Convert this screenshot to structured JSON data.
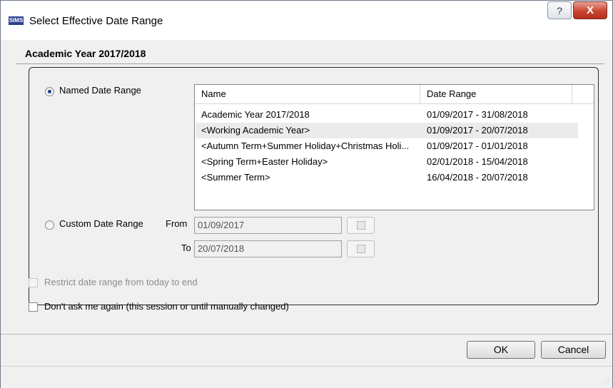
{
  "window": {
    "title": "Select Effective Date Range",
    "app_icon_text": "SIMS",
    "help_label": "?",
    "close_label": "X"
  },
  "group": {
    "title": "Academic Year 2017/2018"
  },
  "named_range": {
    "label": "Named Date Range",
    "checked": true
  },
  "list": {
    "columns": [
      "Name",
      "Date Range"
    ],
    "rows": [
      {
        "name": "Academic Year 2017/2018",
        "range": "01/09/2017 - 31/08/2018"
      },
      {
        "name": "<Working Academic Year>",
        "range": "01/09/2017 - 20/07/2018"
      },
      {
        "name": "<Autumn Term+Summer Holiday+Christmas Holi...",
        "range": "01/09/2017 - 01/01/2018"
      },
      {
        "name": "<Spring Term+Easter Holiday>",
        "range": "02/01/2018 - 15/04/2018"
      },
      {
        "name": "<Summer Term>",
        "range": "16/04/2018 - 20/07/2018"
      }
    ],
    "selected_index": 1
  },
  "custom_range": {
    "label": "Custom Date Range",
    "from_label": "From",
    "from_value": "01/09/2017",
    "to_label": "To",
    "to_value": "20/07/2018"
  },
  "options": {
    "restrict_label": "Restrict date range from today to end",
    "dont_ask_label": "Don't ask me again (this session or until manually changed)"
  },
  "buttons": {
    "ok": "OK",
    "cancel": "Cancel"
  },
  "colors": {
    "close_button": "#c9452f",
    "radio_dot": "#1b3f86",
    "selected_row": "#ebebeb"
  }
}
